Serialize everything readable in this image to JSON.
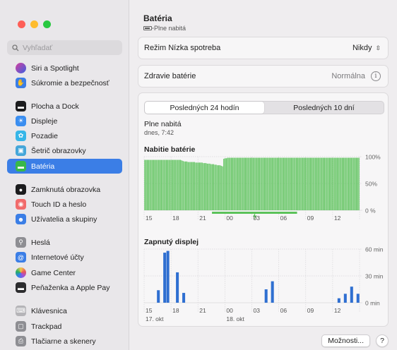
{
  "sidebar": {
    "search_placeholder": "Vyhľadať",
    "items": [
      {
        "label": "Siri a Spotlight",
        "icon": "siri-icon"
      },
      {
        "label": "Súkromie a bezpečnosť",
        "icon": "hand-icon"
      },
      {
        "label": "Plocha a Dock",
        "icon": "dock-icon"
      },
      {
        "label": "Displeje",
        "icon": "sun-icon"
      },
      {
        "label": "Pozadie",
        "icon": "wallpaper-icon"
      },
      {
        "label": "Šetrič obrazovky",
        "icon": "screensaver-icon"
      },
      {
        "label": "Batéria",
        "icon": "battery-icon"
      },
      {
        "label": "Zamknutá obrazovka",
        "icon": "lock-icon"
      },
      {
        "label": "Touch ID a heslo",
        "icon": "fingerprint-icon"
      },
      {
        "label": "Užívatelia a skupiny",
        "icon": "users-icon"
      },
      {
        "label": "Heslá",
        "icon": "key-icon"
      },
      {
        "label": "Internetové účty",
        "icon": "at-icon"
      },
      {
        "label": "Game Center",
        "icon": "gamecenter-icon"
      },
      {
        "label": "Peňaženka a Apple Pay",
        "icon": "wallet-icon"
      },
      {
        "label": "Klávesnica",
        "icon": "keyboard-icon"
      },
      {
        "label": "Trackpad",
        "icon": "trackpad-icon"
      },
      {
        "label": "Tlačiarne a skenery",
        "icon": "printer-icon"
      }
    ],
    "active_index": 6
  },
  "header": {
    "title": "Batéria",
    "subtitle": "Plne nabitá"
  },
  "low_power": {
    "label": "Režim Nízka spotreba",
    "value": "Nikdy"
  },
  "health": {
    "label": "Zdravie batérie",
    "value": "Normálna"
  },
  "tabs": [
    "Posledných 24 hodín",
    "Posledných 10 dní"
  ],
  "active_tab": 0,
  "status": {
    "title": "Plne nabitá",
    "time": "dnes, 7:42"
  },
  "colors": {
    "accent": "#3b7ee6",
    "battery_green": "#5bc25a",
    "screen_blue": "#2f6fd1"
  },
  "chart_data": [
    {
      "type": "bar",
      "title": "Nabitie batérie",
      "x_ticks": [
        "15",
        "18",
        "21",
        "00",
        "03",
        "06",
        "09",
        "12"
      ],
      "y_ticks": [
        "100%",
        "50%",
        "0 %"
      ],
      "ylim": [
        0,
        100
      ],
      "values": [
        94,
        94,
        94,
        94,
        94,
        94,
        94,
        94,
        94,
        94,
        94,
        94,
        94,
        94,
        94,
        94,
        94,
        94,
        94,
        94,
        94,
        94,
        94,
        94,
        94,
        94,
        94,
        94,
        94,
        93,
        92,
        91,
        91,
        91,
        90,
        90,
        90,
        90,
        90,
        90,
        89,
        89,
        89,
        89,
        89,
        89,
        88,
        88,
        88,
        87,
        87,
        87,
        86,
        86,
        86,
        85,
        85,
        84,
        84,
        84,
        83,
        82,
        96,
        97,
        97,
        98,
        98,
        98,
        98,
        98,
        98,
        98,
        98,
        98,
        98,
        98,
        98,
        98,
        98,
        98,
        98,
        98,
        98,
        98,
        98,
        98,
        98,
        98,
        98,
        98,
        98,
        98,
        98,
        98,
        98,
        98,
        98,
        98,
        98,
        98,
        98,
        98,
        98,
        98,
        98,
        98,
        98,
        98,
        98,
        98,
        98,
        98,
        98,
        98,
        98,
        98,
        98,
        98,
        98,
        98,
        98,
        98,
        98,
        98,
        98,
        98,
        98,
        98,
        98,
        98,
        98,
        98,
        98,
        98,
        98,
        98,
        98,
        98,
        98,
        98,
        98,
        98,
        98,
        98,
        98,
        98,
        98,
        98,
        98,
        98,
        98,
        98,
        98,
        98,
        98,
        98,
        98,
        98,
        98,
        98,
        98,
        98,
        98,
        98,
        98,
        98,
        98,
        98,
        98
      ],
      "charging_range": [
        0.315,
        0.71
      ]
    },
    {
      "type": "bar",
      "title": "Zapnutý displej",
      "x_ticks": [
        "15",
        "18",
        "21",
        "00",
        "03",
        "06",
        "09",
        "12"
      ],
      "x_sub": [
        "17. okt",
        "18. okt"
      ],
      "y_ticks": [
        "60 min",
        "30 min",
        "0 min"
      ],
      "ylim": [
        0,
        60
      ],
      "values": [
        0,
        0,
        0,
        0,
        14,
        0,
        56,
        58,
        0,
        0,
        34,
        0,
        11,
        0,
        0,
        0,
        0,
        0,
        0,
        0,
        0,
        0,
        0,
        0,
        0,
        0,
        0,
        0,
        0,
        0,
        0,
        0,
        0,
        0,
        0,
        0,
        0,
        0,
        15,
        0,
        24,
        0,
        0,
        0,
        0,
        0,
        0,
        0,
        0,
        0,
        0,
        0,
        0,
        0,
        0,
        0,
        0,
        0,
        0,
        0,
        0,
        5,
        0,
        10,
        0,
        18,
        0,
        10
      ]
    }
  ],
  "buttons": {
    "options": "Možnosti...",
    "help": "?"
  }
}
